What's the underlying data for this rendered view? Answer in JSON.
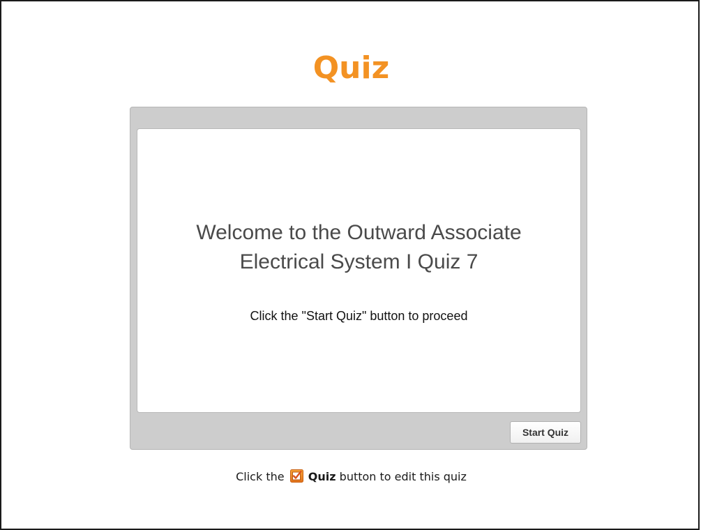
{
  "slide": {
    "title": "Quiz"
  },
  "quiz": {
    "welcome_line1": "Welcome to the Outward Associate",
    "welcome_line2": "Electrical System I Quiz 7",
    "instruction": "Click the \"Start Quiz\" button to proceed",
    "start_button_label": "Start Quiz"
  },
  "footer": {
    "prefix": "Click the",
    "icon": "checkbox-quiz-icon",
    "button_name": "Quiz",
    "suffix": "button to edit this quiz"
  },
  "colors": {
    "title": "#f39223",
    "frame": "#cdcdcd",
    "icon_bg": "#f08a1c"
  }
}
